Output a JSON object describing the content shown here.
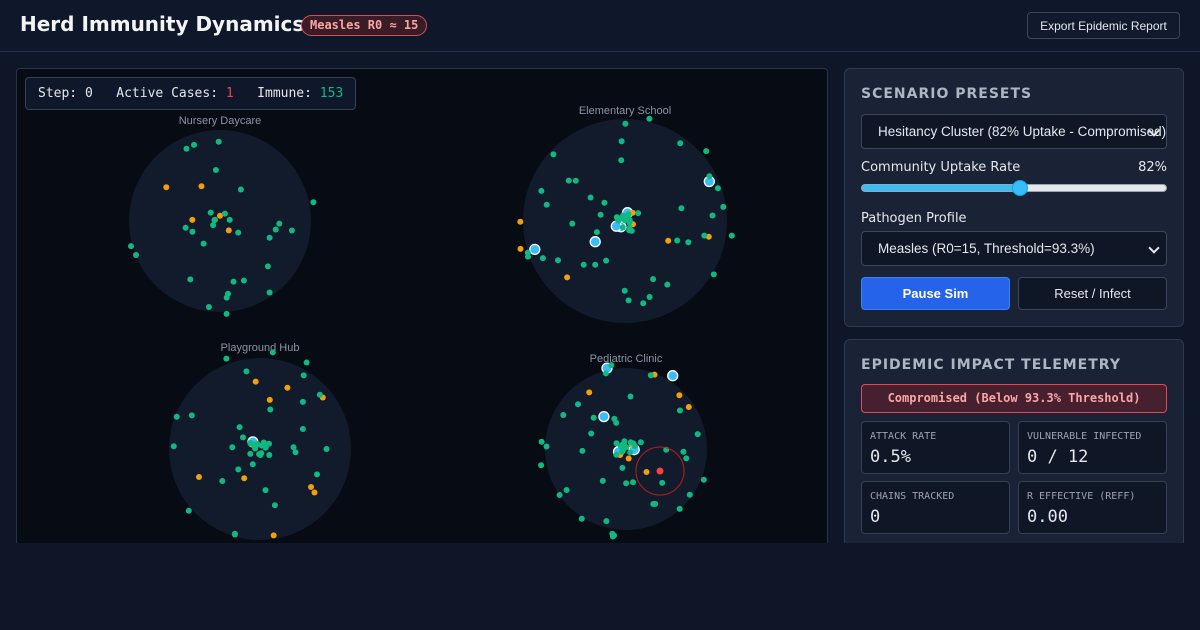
{
  "header": {
    "title": "Herd Immunity Dynamics",
    "badge": "Measles R0 ≈ 15",
    "export_label": "Export Epidemic Report"
  },
  "stats": {
    "step_label": "Step:",
    "step_value": "0",
    "active_label": "Active Cases:",
    "active_value": "1",
    "immune_label": "Immune:",
    "immune_value": "153"
  },
  "colors": {
    "immune": "#10b981",
    "susceptible": "#f59e0b",
    "vulnerable": "#38bdf8",
    "infected": "#ef4444",
    "zone_fill": "#121b2c",
    "accent": "#2563eb"
  },
  "zones": [
    {
      "label": "Nursery Daycare"
    },
    {
      "label": "Elementary School"
    },
    {
      "label": "Playground Hub"
    },
    {
      "label": "Pediatric Clinic"
    }
  ],
  "presets": {
    "title": "SCENARIO PRESETS",
    "scenario_selected": "Hesitancy Cluster (82% Uptake - Compromised)",
    "uptake_label": "Community Uptake Rate",
    "uptake_value": "82%",
    "uptake_fraction": 0.52,
    "pathogen_label": "Pathogen Profile",
    "pathogen_selected": "Measles (R0=15, Threshold=93.3%)",
    "pause_label": "Pause Sim",
    "reset_label": "Reset / Infect"
  },
  "telemetry": {
    "title": "EPIDEMIC IMPACT TELEMETRY",
    "status": "Compromised (Below 93.3% Threshold)",
    "metrics": [
      {
        "label": "ATTACK RATE",
        "value": "0.5%"
      },
      {
        "label": "VULNERABLE INFECTED",
        "value": "0 / 12"
      },
      {
        "label": "CHAINS TRACKED",
        "value": "0"
      },
      {
        "label": "R EFFECTIVE (REFF)",
        "value": "0.00"
      }
    ]
  }
}
